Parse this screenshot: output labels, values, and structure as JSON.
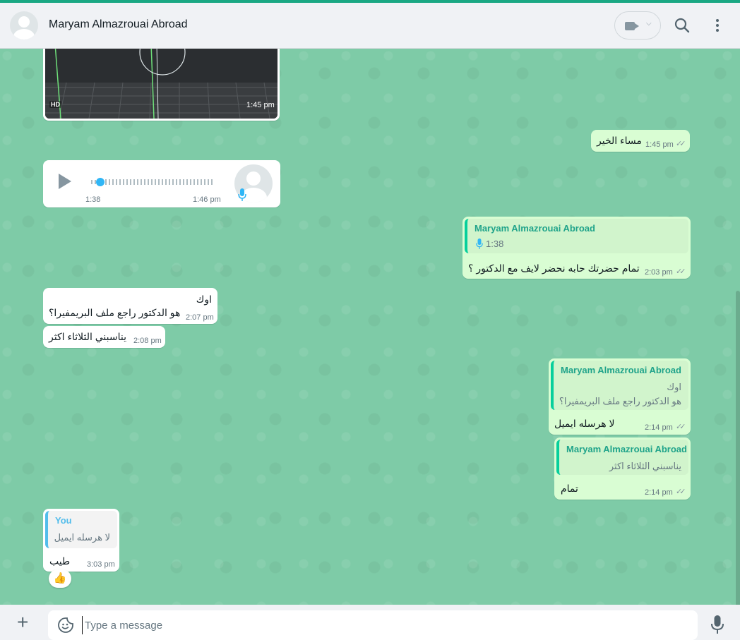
{
  "header": {
    "contact_name": "Maryam Almazrouai Abroad"
  },
  "messages": {
    "video_time": "1:45 pm",
    "video_badge": "HD",
    "out1_text": "مساء الخير",
    "out1_time": "1:45 pm",
    "voice_duration": "1:38",
    "voice_time": "1:46 pm",
    "out2_quote_author": "Maryam Almazrouai Abroad",
    "out2_quote_duration": "1:38",
    "out2_text": "تمام حضرتك حابه نحضر لايف مع الدكتور ؟",
    "out2_time": "2:03 pm",
    "in1_line1": "اوك",
    "in1_line2": "هو الدكتور راجع ملف البريمفيرا؟",
    "in1_time": "2:07 pm",
    "in2_text": "يناسبني الثلاثاء اكثر",
    "in2_time": "2:08 pm",
    "out3_quote_author": "Maryam Almazrouai Abroad",
    "out3_quote_line1": "اوك",
    "out3_quote_line2": "هو الدكتور راجع ملف البريمفيرا؟",
    "out3_text": "لا هرسله ايميل",
    "out3_time": "2:14 pm",
    "out4_quote_author": "Maryam Almazrouai Abroad",
    "out4_quote_text": "يناسبني الثلاثاء اكثر",
    "out4_text": "تمام",
    "out4_time": "2:14 pm",
    "in3_quote_author": "You",
    "in3_quote_text": "لا هرسله ايميل",
    "in3_text": "طيب",
    "in3_time": "3:03 pm",
    "in3_reaction": "👍"
  },
  "composer": {
    "placeholder": "Type a message"
  },
  "colors": {
    "chat_bg": "#7ecba7",
    "outgoing_bubble": "#d9fdd3",
    "incoming_bubble": "#ffffff",
    "quote_author": "#1fa38a",
    "accent": "#1aa883"
  },
  "icons": {
    "video_call": "video-camera-icon",
    "search": "search-icon",
    "menu": "kebab-menu-icon",
    "attach": "plus-icon",
    "sticker": "sticker-icon",
    "voice": "microphone-icon",
    "play": "play-icon",
    "read_receipt": "double-check-icon"
  }
}
